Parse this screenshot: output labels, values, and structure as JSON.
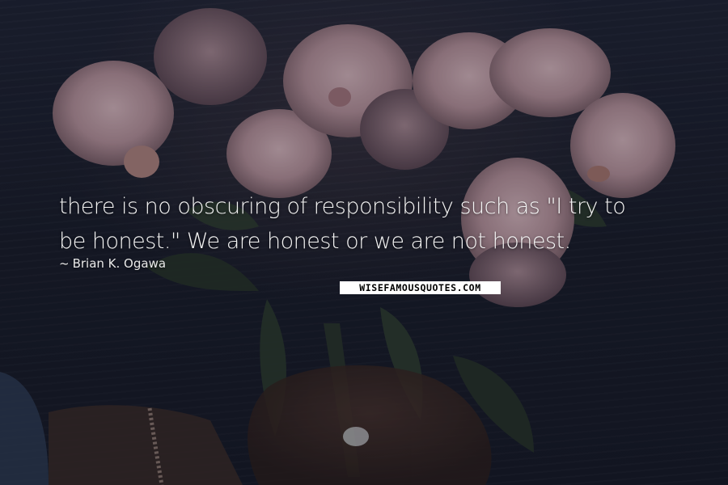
{
  "quote": {
    "line1": "there is no obscuring of responsibility such as \"I try to",
    "line2": "be honest.\" We are honest or we are not honest."
  },
  "author": {
    "dash": "~",
    "name": "Brian K. Ogawa"
  },
  "watermark": {
    "text": "WISEFAMOUSQUOTES.COM"
  },
  "colors": {
    "background": "#1b1f2c",
    "text": "#f4f4f4",
    "peony": "#c7a3ab",
    "leaf": "#2e3d2c",
    "watermark_bg": "#ffffff"
  }
}
